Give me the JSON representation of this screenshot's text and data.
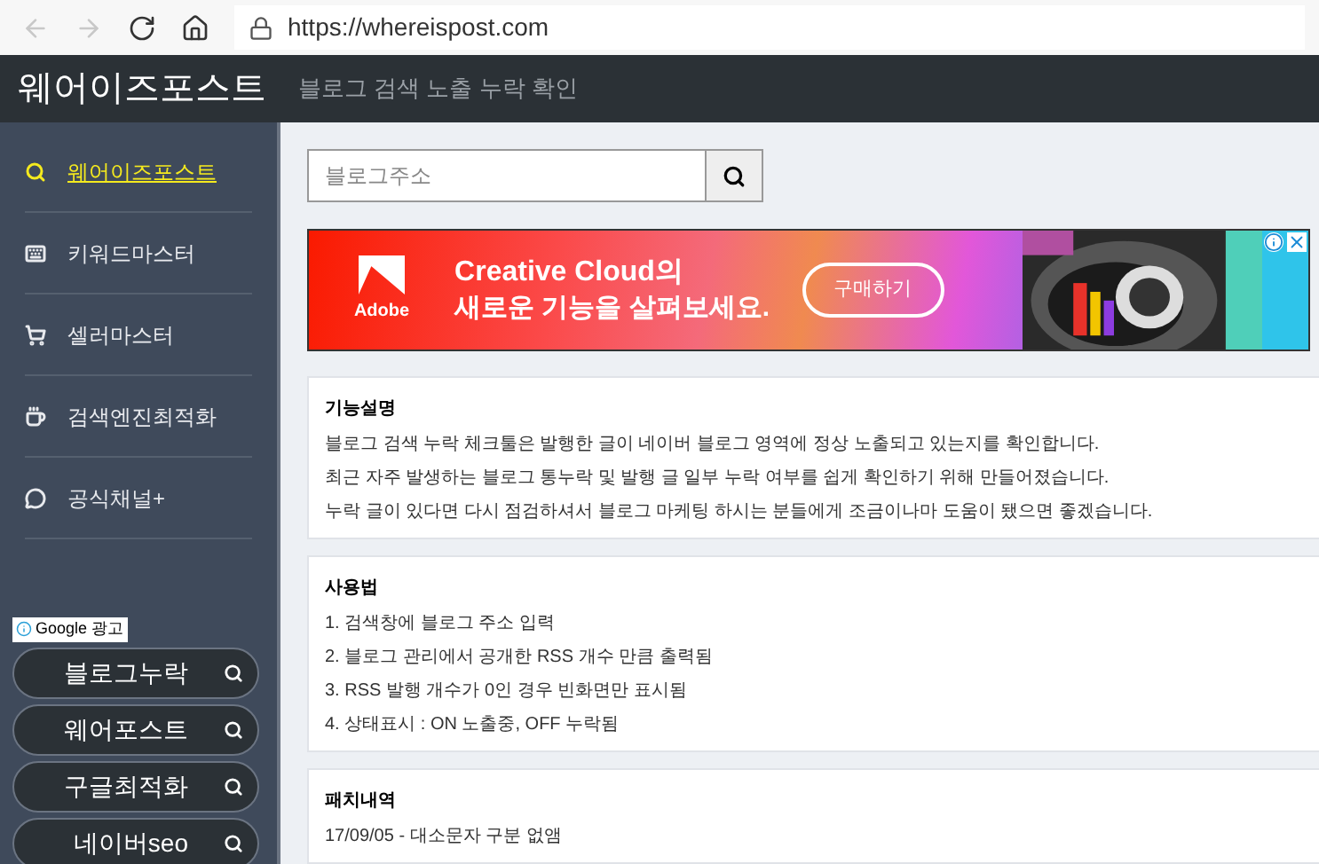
{
  "browser": {
    "url": "https://whereispost.com"
  },
  "header": {
    "title": "웨어이즈포스트",
    "subtitle": "블로그 검색 노출 누락 확인"
  },
  "sidebar": {
    "items": [
      {
        "label": "웨어이즈포스트",
        "selected": true
      },
      {
        "label": "키워드마스터",
        "selected": false
      },
      {
        "label": "셀러마스터",
        "selected": false
      },
      {
        "label": "검색엔진최적화",
        "selected": false
      },
      {
        "label": "공식채널+",
        "selected": false
      }
    ],
    "ad_label": "Google 광고",
    "ad_buttons": [
      "블로그누락",
      "웨어포스트",
      "구글최적화",
      "네이버seo"
    ]
  },
  "search": {
    "placeholder": "블로그주소"
  },
  "ad": {
    "brand": "Adobe",
    "headline": "Creative Cloud의",
    "subline": "새로운 기능을 살펴보세요.",
    "button": "구매하기"
  },
  "sections": [
    {
      "title": "기능설명",
      "lines": [
        "블로그 검색 누락 체크툴은 발행한 글이 네이버 블로그 영역에 정상 노출되고 있는지를 확인합니다.",
        "최근 자주 발생하는 블로그 통누락 및 발행 글 일부 누락 여부를 쉽게 확인하기 위해 만들어졌습니다.",
        "누락 글이 있다면 다시 점검하셔서 블로그 마케팅 하시는 분들에게 조금이나마 도움이 됐으면 좋겠습니다."
      ]
    },
    {
      "title": "사용법",
      "lines": [
        "1. 검색창에 블로그 주소 입력",
        "2. 블로그 관리에서 공개한 RSS 개수 만큼 출력됨",
        "3. RSS 발행 개수가 0인 경우 빈화면만 표시됨",
        "4. 상태표시 : ON 노출중, OFF 누락됨"
      ]
    },
    {
      "title": "패치내역",
      "lines": [
        "17/09/05 - 대소문자 구분 없앰"
      ]
    }
  ]
}
